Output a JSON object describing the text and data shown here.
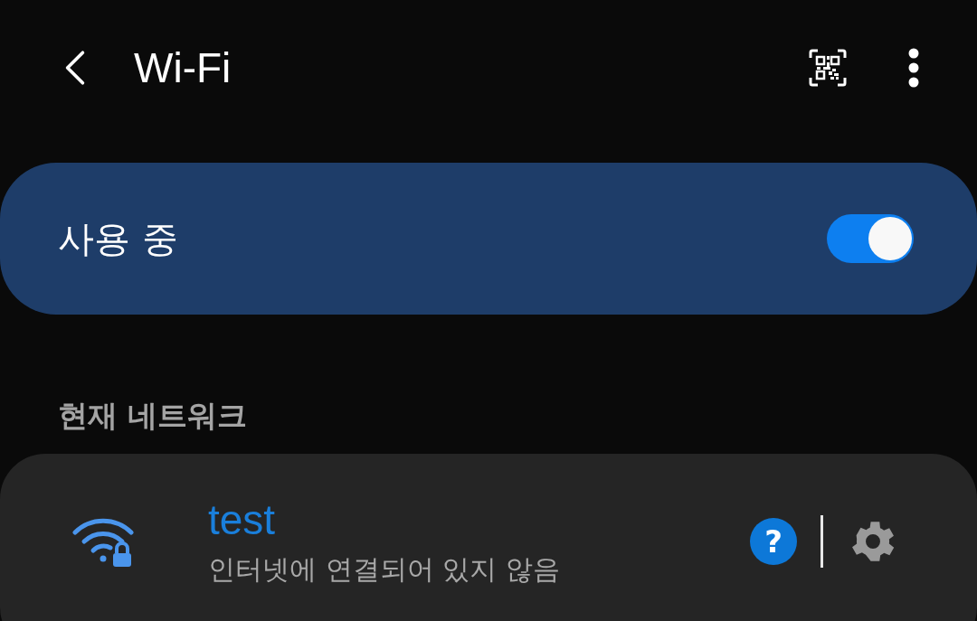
{
  "header": {
    "title": "Wi-Fi"
  },
  "master_switch": {
    "label": "사용 중",
    "on": true
  },
  "current_network": {
    "heading": "현재 네트워크",
    "network": {
      "name": "test",
      "status": "인터넷에 연결되어 있지 않음",
      "connected": true,
      "help_icon": "?"
    }
  }
}
